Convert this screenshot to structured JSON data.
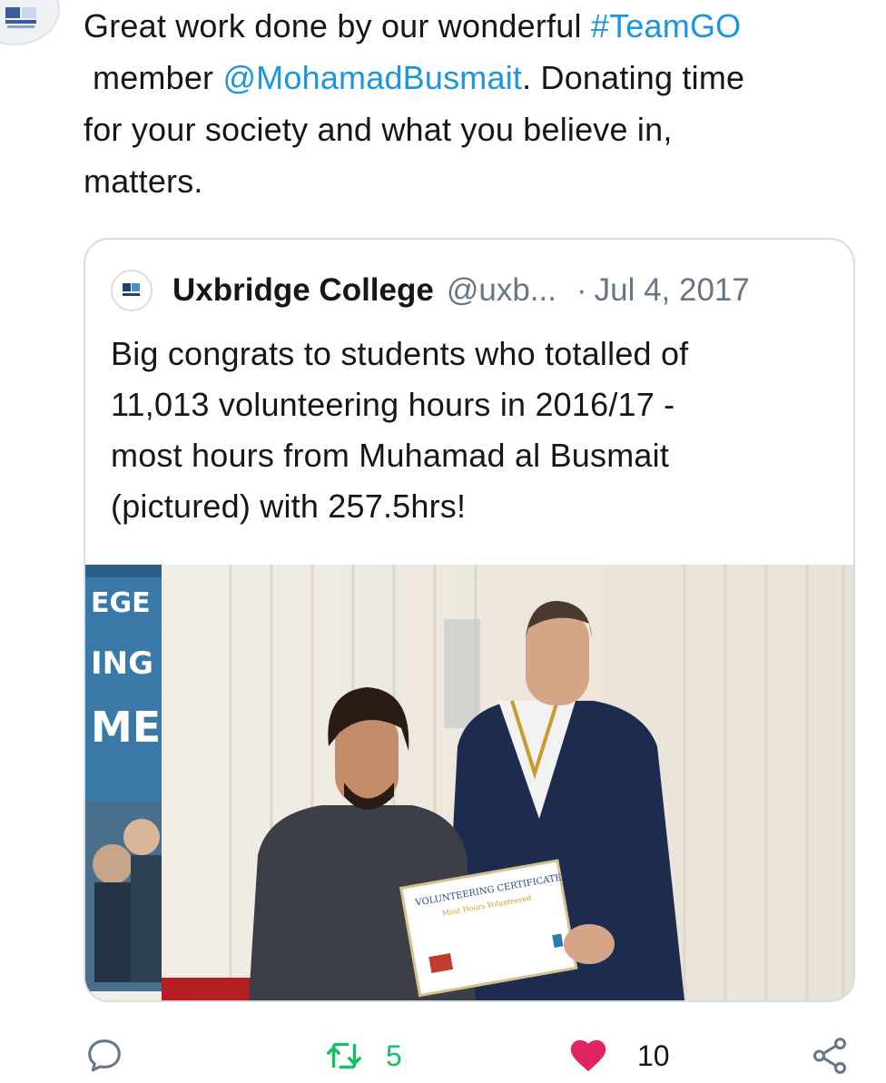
{
  "tweet": {
    "text_line1_pre": "Great work done by our wonderful ",
    "hashtag": "#TeamGO",
    "text_line2_pre": "member ",
    "mention": "@MohamadBusmait",
    "text_line2_post": ". Donating time",
    "text_line3": "for your society and what you believe in,",
    "text_line4": "matters."
  },
  "quoted": {
    "name": "Uxbridge College",
    "handle": "@uxb...",
    "separator": "·",
    "date": "Jul 4, 2017",
    "text_lines": [
      "Big congrats to students who totalled of",
      "11,013 volunteering hours in 2016/17 -",
      "most hours from Muhamad al Busmait",
      "(pictured) with 257.5hrs!"
    ],
    "photo": {
      "banner_lines": [
        "EGE",
        "ING",
        "ME"
      ],
      "certificate_title": "VOLUNTEERING CERTIFICATE",
      "certificate_subtitle": "Most Hours Volunteered"
    }
  },
  "actions": {
    "reply_icon": "speech-bubble-icon",
    "retweet_icon": "retweet-icon",
    "retweet_count": "5",
    "like_icon": "heart-icon",
    "like_count": "10",
    "share_icon": "share-icon",
    "like_color": "#e0245e",
    "retweet_color": "#17bf63"
  }
}
